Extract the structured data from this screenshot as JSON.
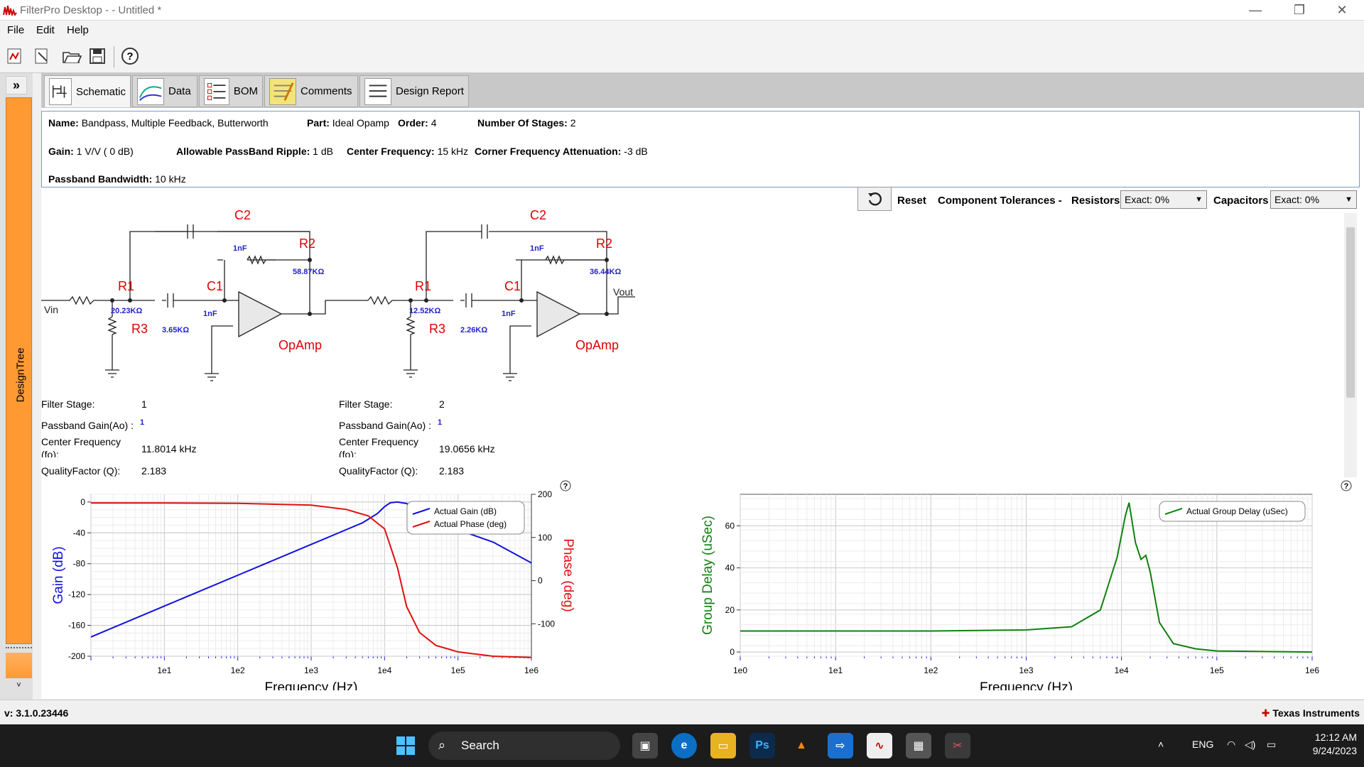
{
  "window": {
    "title": "FilterPro Desktop -  - Untitled *",
    "minimize": "—",
    "restore": "❐",
    "close": "✕"
  },
  "menu": {
    "file": "File",
    "edit": "Edit",
    "help": "Help"
  },
  "toolbar": {
    "new": "new-design-icon",
    "wizard": "wizard-icon",
    "open": "open-icon",
    "save": "save-icon",
    "help": "help-icon"
  },
  "sidebar": {
    "expand": "»",
    "label": "DesignTree",
    "down": "˅"
  },
  "tabs": [
    {
      "label": "Schematic"
    },
    {
      "label": "Data"
    },
    {
      "label": "BOM"
    },
    {
      "label": "Comments"
    },
    {
      "label": "Design Report"
    }
  ],
  "info": {
    "name_label": "Name:",
    "name": "Bandpass, Multiple Feedback, Butterworth",
    "part_label": "Part:",
    "part": "Ideal Opamp",
    "order_label": "Order:",
    "order": "4",
    "stages_label": "Number Of Stages:",
    "stages": "2",
    "gain_label": "Gain:",
    "gain": "1 V/V ( 0 dB)",
    "ripple_label": "Allowable PassBand Ripple:",
    "ripple": "1 dB",
    "cf_label": "Center Frequency:",
    "cf": "15 kHz",
    "cfa_label": "Corner Frequency Attenuation:",
    "cfa": "-3 dB",
    "bw_label": "Passband Bandwidth:",
    "bw": "10 kHz"
  },
  "controls": {
    "reset": "Reset",
    "tolerances": "Component Tolerances -",
    "resistors": "Resistors",
    "resistors_value": "Exact: 0%",
    "capacitors": "Capacitors",
    "capacitors_value": "Exact: 0%"
  },
  "schematic": {
    "stage1": {
      "c2": "C2",
      "c2v": "1nF",
      "r2": "R2",
      "r2v": "58.87KΩ",
      "r1": "R1",
      "r1v": "20.23KΩ",
      "c1": "C1",
      "c1v": "1nF",
      "r3": "R3",
      "r3v": "3.65KΩ",
      "opamp": "OpAmp",
      "vin": "Vin"
    },
    "stage2": {
      "c2": "C2",
      "c2v": "1nF",
      "r2": "R2",
      "r2v": "36.44KΩ",
      "r1": "R1",
      "r1v": "12.52KΩ",
      "c1": "C1",
      "c1v": "1nF",
      "r3": "R3",
      "r3v": "2.26KΩ",
      "opamp": "OpAmp",
      "vout": "Vout"
    }
  },
  "stages": [
    {
      "stage_label": "Filter Stage:",
      "stage": "1",
      "gain_label": "Passband Gain(Ao) :",
      "gain": "1",
      "fo_label1": "Center Frequency",
      "fo_label2": "(fo):",
      "fo": "11.8014 kHz",
      "q_label": "QualityFactor (Q):",
      "q": "2.183"
    },
    {
      "stage_label": "Filter Stage:",
      "stage": "2",
      "gain_label": "Passband Gain(Ao) :",
      "gain": "1",
      "fo_label1": "Center Frequency",
      "fo_label2": "(fo):",
      "fo": "19.0656 kHz",
      "q_label": "QualityFactor (Q):",
      "q": "2.183"
    }
  ],
  "chart_data": [
    {
      "type": "line",
      "xlabel": "Frequency (Hz)",
      "ylabel": "Gain (dB)",
      "y2label": "Phase (deg)",
      "xscale": "log",
      "xlim": [
        1,
        1000000
      ],
      "ylim": [
        -200,
        10
      ],
      "y2lim": [
        -175,
        200
      ],
      "xticks": [
        "1e1",
        "1e2",
        "1e3",
        "1e4",
        "1e5",
        "1e6"
      ],
      "yticks": [
        "0",
        "-40",
        "-80",
        "-120",
        "-160",
        "-200"
      ],
      "y2ticks": [
        "200",
        "100",
        "0",
        "-100"
      ],
      "legend": "top-right",
      "grid": true,
      "series": [
        {
          "name": "Actual Gain (dB)",
          "axis": "left",
          "color": "#1010e0",
          "x": [
            1,
            10,
            100,
            1000,
            5000,
            8000,
            10000,
            12000,
            15000,
            20000,
            30000,
            50000,
            100000,
            300000,
            1000000
          ],
          "y": [
            -175,
            -135,
            -95,
            -55,
            -27,
            -15,
            -6,
            -1,
            0,
            -2,
            -12,
            -24,
            -36,
            -52,
            -79
          ]
        },
        {
          "name": "Actual Phase (deg)",
          "axis": "right",
          "color": "#e01010",
          "x": [
            1,
            10,
            100,
            1000,
            3000,
            6000,
            10000,
            12000,
            15000,
            20000,
            30000,
            50000,
            100000,
            300000,
            1000000
          ],
          "y": [
            180,
            180,
            179,
            175,
            165,
            150,
            120,
            80,
            30,
            -60,
            -120,
            -150,
            -165,
            -175,
            -178
          ]
        }
      ]
    },
    {
      "type": "line",
      "xlabel": "Frequency (Hz)",
      "ylabel": "Group Delay (uSec)",
      "xscale": "log",
      "xlim": [
        1,
        1000000
      ],
      "ylim": [
        -2,
        75
      ],
      "xticks": [
        "1e0",
        "1e1",
        "1e2",
        "1e3",
        "1e4",
        "1e5",
        "1e6"
      ],
      "yticks": [
        "0",
        "20",
        "40",
        "60"
      ],
      "legend": "top-right",
      "grid": true,
      "series": [
        {
          "name": "Actual Group Delay (uSec)",
          "color": "#108010",
          "x": [
            1,
            10,
            100,
            1000,
            3000,
            6000,
            9000,
            11000,
            12000,
            14000,
            16000,
            18000,
            20000,
            25000,
            35000,
            60000,
            100000,
            1000000
          ],
          "y": [
            10,
            10,
            10,
            10.5,
            12,
            20,
            45,
            65,
            71,
            52,
            44,
            46,
            38,
            14,
            4,
            1.5,
            0.5,
            0
          ]
        }
      ]
    }
  ],
  "status": {
    "version": "v: 3.1.0.23446",
    "ti": "Texas Instruments"
  },
  "taskbar": {
    "search": "Search",
    "lang": "ENG",
    "time": "12:12 AM",
    "date": "9/24/2023"
  }
}
